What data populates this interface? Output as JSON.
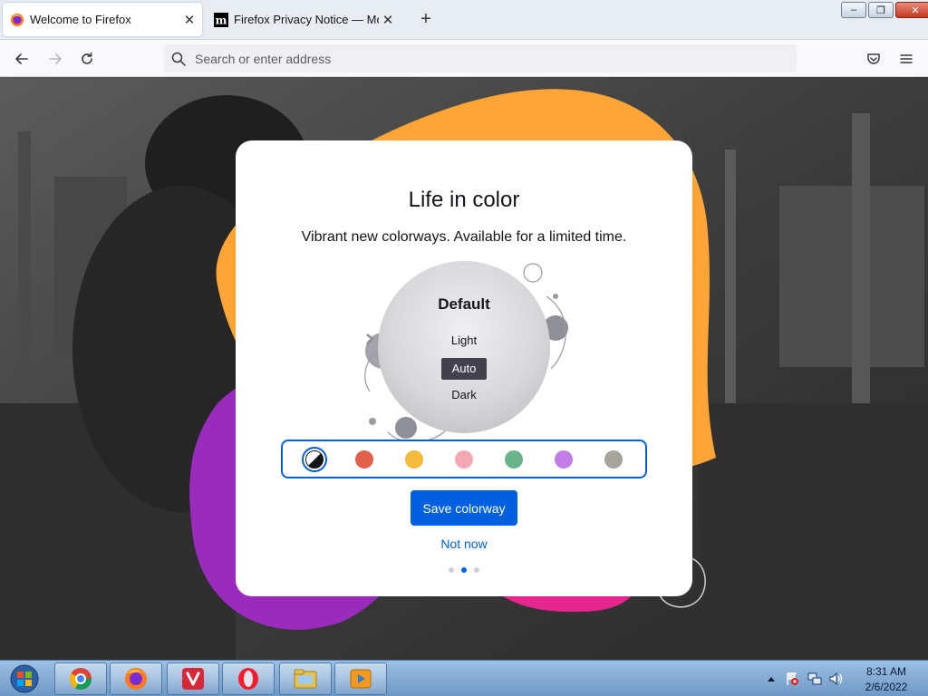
{
  "window": {
    "controls": {
      "minimize": "–",
      "maximize": "❐",
      "close": "✕"
    }
  },
  "tabs": [
    {
      "title": "Welcome to Firefox",
      "icon": "firefox-icon",
      "active": true,
      "close": "✕"
    },
    {
      "title": "Firefox Privacy Notice — Mozilla",
      "icon": "mozilla-m-icon",
      "active": false,
      "close": "✕"
    }
  ],
  "toolbar": {
    "new_tab": "+",
    "address_placeholder": "Search or enter address",
    "address_value": ""
  },
  "onboarding": {
    "title": "Life in color",
    "subtitle": "Vibrant new colorways. Available for a limited time.",
    "theme_name": "Default",
    "theme_options": [
      {
        "label": "Light",
        "selected": false
      },
      {
        "label": "Auto",
        "selected": true
      },
      {
        "label": "Dark",
        "selected": false
      }
    ],
    "colorways": [
      {
        "name": "default",
        "color": "#15141a",
        "selected": true
      },
      {
        "name": "red",
        "color": "#e0604a"
      },
      {
        "name": "yellow",
        "color": "#f5b93b"
      },
      {
        "name": "pink",
        "color": "#f3a9b3"
      },
      {
        "name": "green",
        "color": "#6bb38a"
      },
      {
        "name": "purple",
        "color": "#c07ee6"
      },
      {
        "name": "gray",
        "color": "#a7a49b"
      }
    ],
    "primary_button": "Save colorway",
    "secondary_link": "Not now",
    "steps": {
      "total": 3,
      "current": 2
    }
  },
  "colors": {
    "accent": "#0060df",
    "blob_orange": "#ffa436",
    "blob_purple": "#9a2bbd",
    "blob_pink": "#e6268f"
  },
  "taskbar": {
    "apps": [
      "chrome-icon",
      "firefox-icon",
      "vivaldi-icon",
      "opera-icon",
      "file-explorer-icon",
      "media-player-icon"
    ],
    "time": "8:31 AM",
    "date": "2/6/2022"
  }
}
